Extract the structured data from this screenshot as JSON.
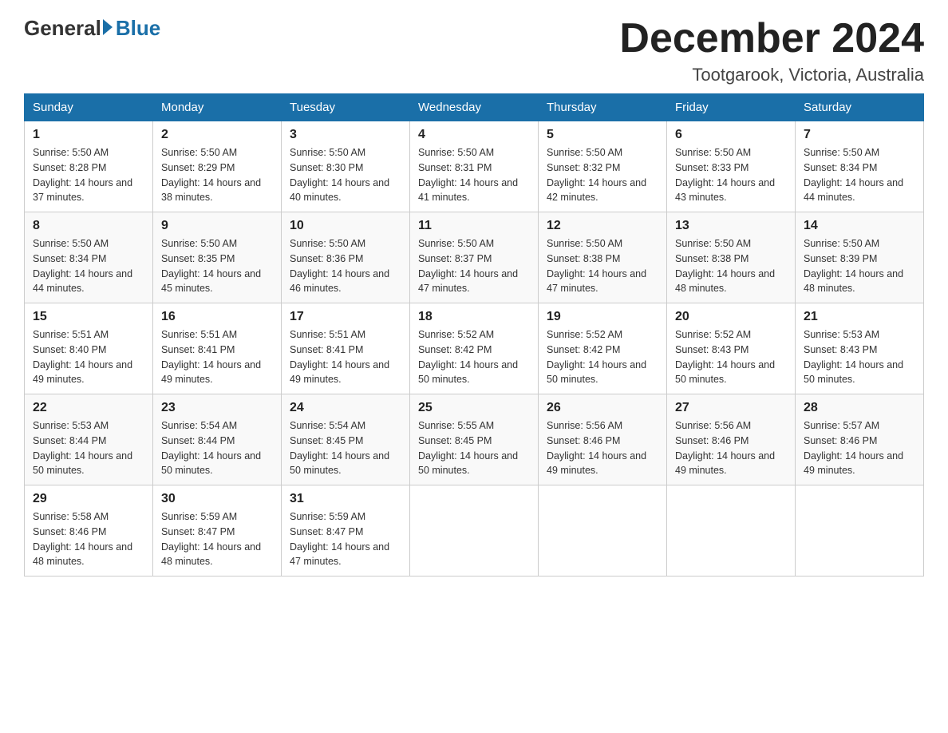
{
  "header": {
    "logo_general": "General",
    "logo_blue": "Blue",
    "month_title": "December 2024",
    "location": "Tootgarook, Victoria, Australia"
  },
  "days_of_week": [
    "Sunday",
    "Monday",
    "Tuesday",
    "Wednesday",
    "Thursday",
    "Friday",
    "Saturday"
  ],
  "weeks": [
    [
      {
        "day": "1",
        "sunrise": "5:50 AM",
        "sunset": "8:28 PM",
        "daylight": "14 hours and 37 minutes."
      },
      {
        "day": "2",
        "sunrise": "5:50 AM",
        "sunset": "8:29 PM",
        "daylight": "14 hours and 38 minutes."
      },
      {
        "day": "3",
        "sunrise": "5:50 AM",
        "sunset": "8:30 PM",
        "daylight": "14 hours and 40 minutes."
      },
      {
        "day": "4",
        "sunrise": "5:50 AM",
        "sunset": "8:31 PM",
        "daylight": "14 hours and 41 minutes."
      },
      {
        "day": "5",
        "sunrise": "5:50 AM",
        "sunset": "8:32 PM",
        "daylight": "14 hours and 42 minutes."
      },
      {
        "day": "6",
        "sunrise": "5:50 AM",
        "sunset": "8:33 PM",
        "daylight": "14 hours and 43 minutes."
      },
      {
        "day": "7",
        "sunrise": "5:50 AM",
        "sunset": "8:34 PM",
        "daylight": "14 hours and 44 minutes."
      }
    ],
    [
      {
        "day": "8",
        "sunrise": "5:50 AM",
        "sunset": "8:34 PM",
        "daylight": "14 hours and 44 minutes."
      },
      {
        "day": "9",
        "sunrise": "5:50 AM",
        "sunset": "8:35 PM",
        "daylight": "14 hours and 45 minutes."
      },
      {
        "day": "10",
        "sunrise": "5:50 AM",
        "sunset": "8:36 PM",
        "daylight": "14 hours and 46 minutes."
      },
      {
        "day": "11",
        "sunrise": "5:50 AM",
        "sunset": "8:37 PM",
        "daylight": "14 hours and 47 minutes."
      },
      {
        "day": "12",
        "sunrise": "5:50 AM",
        "sunset": "8:38 PM",
        "daylight": "14 hours and 47 minutes."
      },
      {
        "day": "13",
        "sunrise": "5:50 AM",
        "sunset": "8:38 PM",
        "daylight": "14 hours and 48 minutes."
      },
      {
        "day": "14",
        "sunrise": "5:50 AM",
        "sunset": "8:39 PM",
        "daylight": "14 hours and 48 minutes."
      }
    ],
    [
      {
        "day": "15",
        "sunrise": "5:51 AM",
        "sunset": "8:40 PM",
        "daylight": "14 hours and 49 minutes."
      },
      {
        "day": "16",
        "sunrise": "5:51 AM",
        "sunset": "8:41 PM",
        "daylight": "14 hours and 49 minutes."
      },
      {
        "day": "17",
        "sunrise": "5:51 AM",
        "sunset": "8:41 PM",
        "daylight": "14 hours and 49 minutes."
      },
      {
        "day": "18",
        "sunrise": "5:52 AM",
        "sunset": "8:42 PM",
        "daylight": "14 hours and 50 minutes."
      },
      {
        "day": "19",
        "sunrise": "5:52 AM",
        "sunset": "8:42 PM",
        "daylight": "14 hours and 50 minutes."
      },
      {
        "day": "20",
        "sunrise": "5:52 AM",
        "sunset": "8:43 PM",
        "daylight": "14 hours and 50 minutes."
      },
      {
        "day": "21",
        "sunrise": "5:53 AM",
        "sunset": "8:43 PM",
        "daylight": "14 hours and 50 minutes."
      }
    ],
    [
      {
        "day": "22",
        "sunrise": "5:53 AM",
        "sunset": "8:44 PM",
        "daylight": "14 hours and 50 minutes."
      },
      {
        "day": "23",
        "sunrise": "5:54 AM",
        "sunset": "8:44 PM",
        "daylight": "14 hours and 50 minutes."
      },
      {
        "day": "24",
        "sunrise": "5:54 AM",
        "sunset": "8:45 PM",
        "daylight": "14 hours and 50 minutes."
      },
      {
        "day": "25",
        "sunrise": "5:55 AM",
        "sunset": "8:45 PM",
        "daylight": "14 hours and 50 minutes."
      },
      {
        "day": "26",
        "sunrise": "5:56 AM",
        "sunset": "8:46 PM",
        "daylight": "14 hours and 49 minutes."
      },
      {
        "day": "27",
        "sunrise": "5:56 AM",
        "sunset": "8:46 PM",
        "daylight": "14 hours and 49 minutes."
      },
      {
        "day": "28",
        "sunrise": "5:57 AM",
        "sunset": "8:46 PM",
        "daylight": "14 hours and 49 minutes."
      }
    ],
    [
      {
        "day": "29",
        "sunrise": "5:58 AM",
        "sunset": "8:46 PM",
        "daylight": "14 hours and 48 minutes."
      },
      {
        "day": "30",
        "sunrise": "5:59 AM",
        "sunset": "8:47 PM",
        "daylight": "14 hours and 48 minutes."
      },
      {
        "day": "31",
        "sunrise": "5:59 AM",
        "sunset": "8:47 PM",
        "daylight": "14 hours and 47 minutes."
      },
      null,
      null,
      null,
      null
    ]
  ],
  "labels": {
    "sunrise_prefix": "Sunrise: ",
    "sunset_prefix": "Sunset: ",
    "daylight_prefix": "Daylight: "
  }
}
